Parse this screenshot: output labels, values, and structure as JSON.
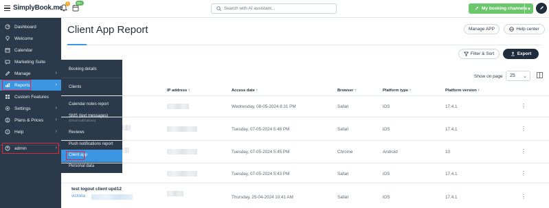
{
  "header": {
    "logo": "SimplyBook.me",
    "bell_badge": "1",
    "calendar_badge": "30+",
    "search_placeholder": "Search with AI assistant...",
    "booking_channels": "My booking channels"
  },
  "sidebar": {
    "items": [
      {
        "label": "Dashboard",
        "icon": "dashboard-icon"
      },
      {
        "label": "Welcome",
        "icon": "lightbulb-icon"
      },
      {
        "label": "Calendar",
        "icon": "calendar-icon"
      },
      {
        "label": "Marketing Suite",
        "icon": "marketing-icon"
      },
      {
        "label": "Manage",
        "icon": "pencil-icon"
      },
      {
        "label": "Reports",
        "icon": "chart-icon"
      },
      {
        "label": "Custom Features",
        "icon": "puzzle-icon"
      },
      {
        "label": "Settings",
        "icon": "gear-icon"
      },
      {
        "label": "Plans & Prices",
        "icon": "price-icon"
      },
      {
        "label": "Help",
        "icon": "help-icon"
      }
    ],
    "admin": "admin"
  },
  "submenu": {
    "items": [
      {
        "label": "Booking details"
      },
      {
        "label": "Clients"
      },
      {
        "label": "Calendar notes report"
      },
      {
        "label": "SMS (text messages)",
        "sub": "(Email notifications)"
      },
      {
        "label": "Reviews"
      },
      {
        "label": "Push notifications report"
      },
      {
        "label": "Client app"
      },
      {
        "label": "Personal data"
      }
    ]
  },
  "main": {
    "title": "Client App Report",
    "manage_app": "Manage APP",
    "help_center": "Help center",
    "filter_sort": "Filter & Sort",
    "export": "Export",
    "show_on_page": "Show on page",
    "per_page": "25"
  },
  "table": {
    "headers": [
      "IP address ↑",
      "Access date ↑",
      "Browser ↑",
      "Platform type ↑",
      "Platform version ↑"
    ],
    "rows": [
      {
        "date": "Wednesday, 08-05-2024 8:31 PM",
        "browser": "Safari",
        "platform": "iOS",
        "version": "17.4.1"
      },
      {
        "date": "Tuesday, 07-05-2024 5:48 PM",
        "browser": "Safari",
        "platform": "iOS",
        "version": "17.4.1"
      },
      {
        "date": "Tuesday, 07-05-2024 5:45 PM",
        "browser": "Chrome",
        "platform": "Android",
        "version": "10"
      },
      {
        "date": "Tuesday, 07-05-2024 5:43 PM",
        "browser": "Safari",
        "platform": "iOS",
        "version": "17.4.1"
      },
      {
        "date": "Thursday, 25-04-2024 10:41 AM",
        "browser": "Safari",
        "platform": "iOS",
        "version": "17.4.1"
      }
    ],
    "last_client_name": "test logout client upd12",
    "last_client_email": "victoria"
  }
}
